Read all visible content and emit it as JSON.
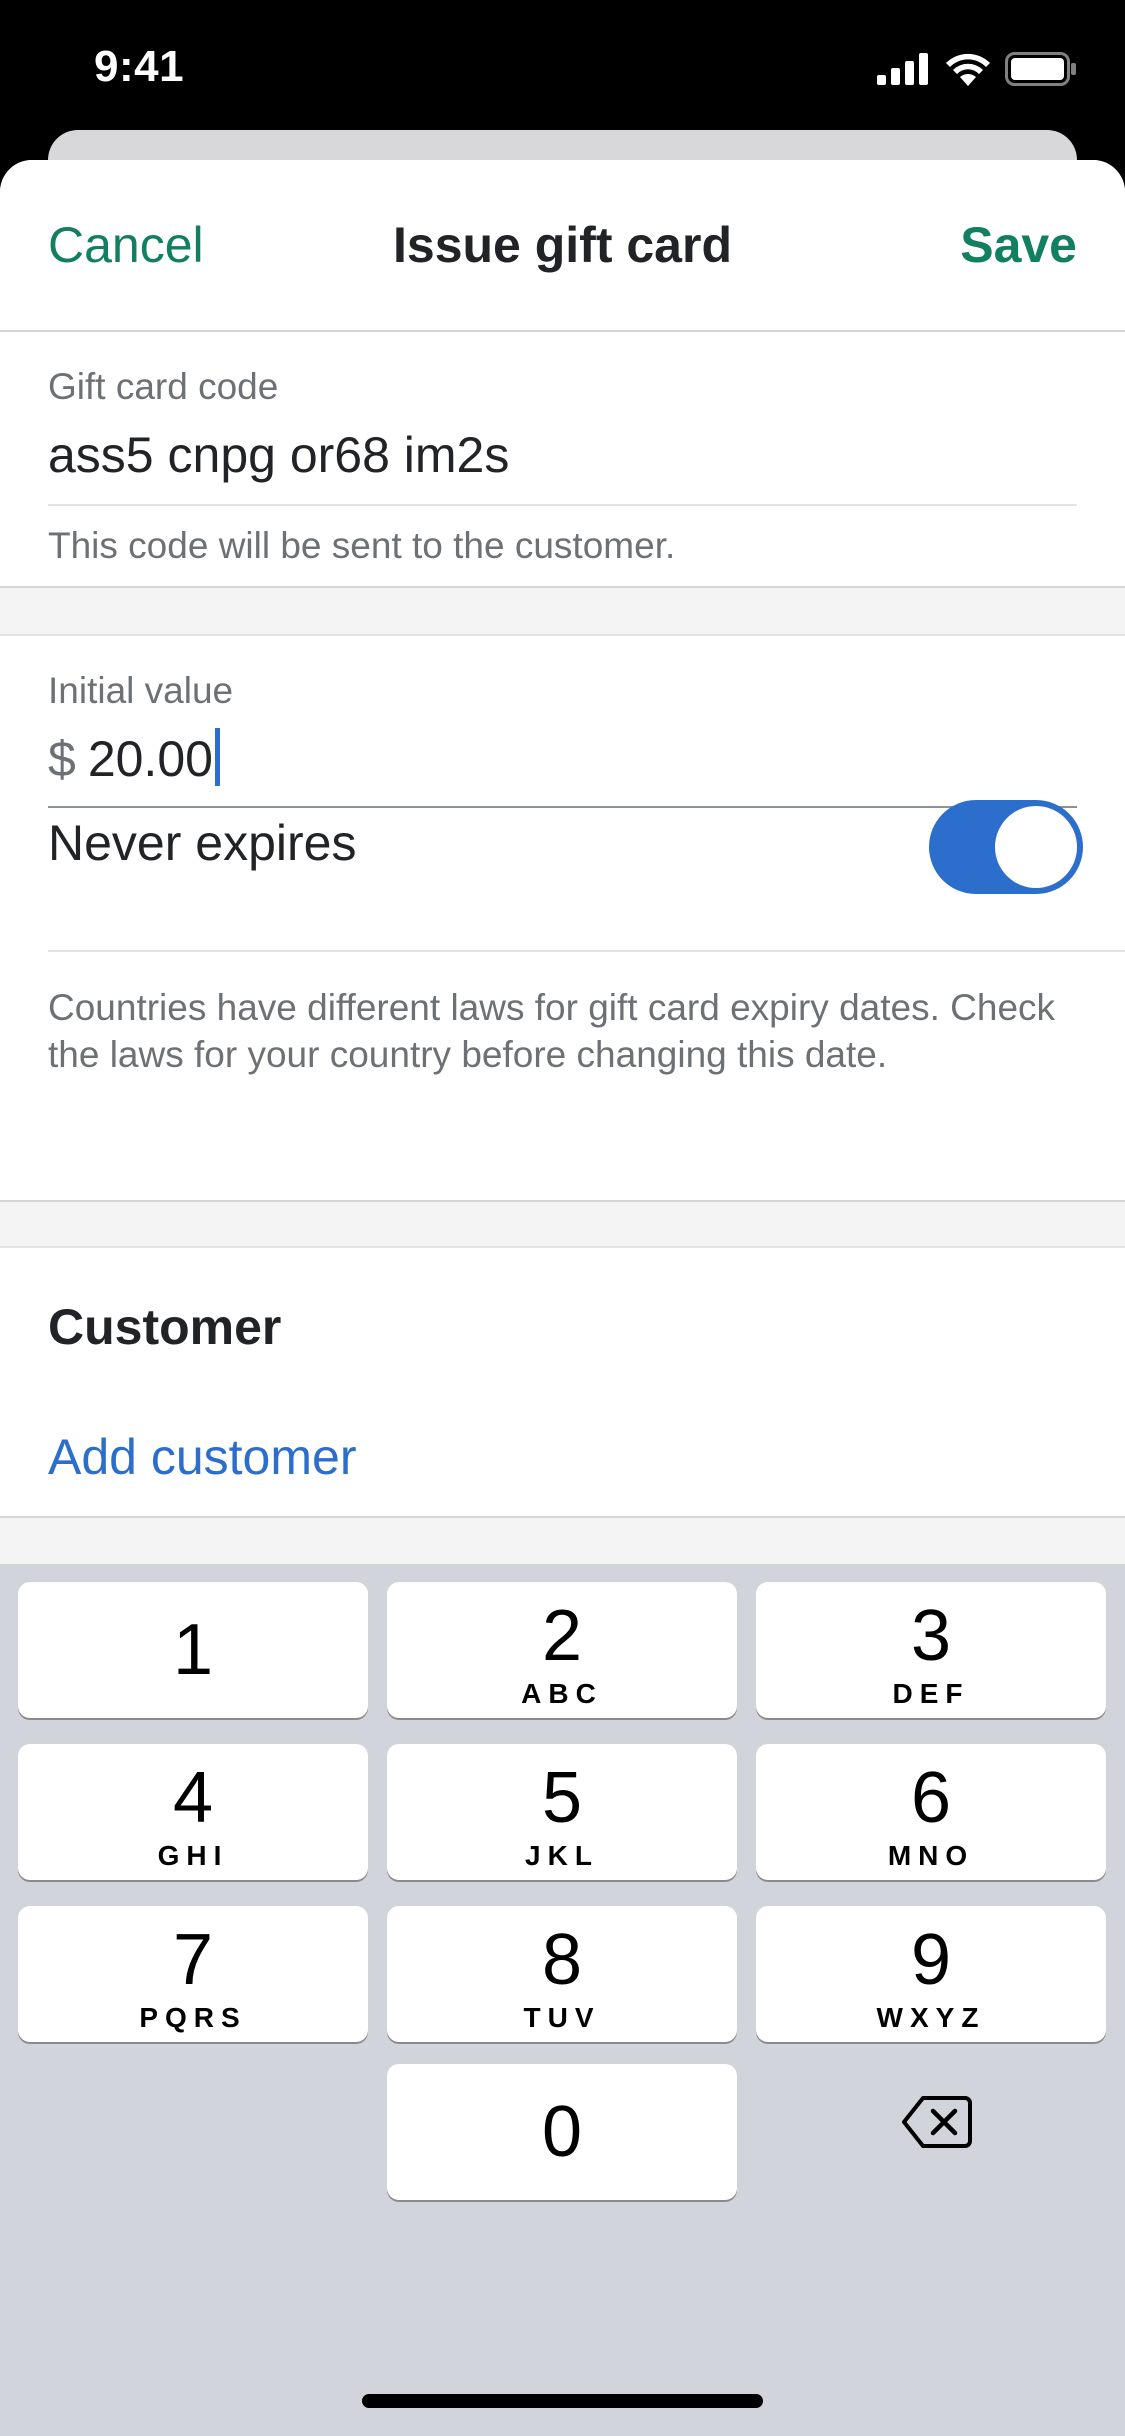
{
  "status_bar": {
    "time": "9:41"
  },
  "nav": {
    "cancel_label": "Cancel",
    "title": "Issue gift card",
    "save_label": "Save"
  },
  "gift_card": {
    "code_label": "Gift card code",
    "code_value": "ass5 cnpg or68 im2s",
    "code_help": "This code will be sent to the customer."
  },
  "value": {
    "label": "Initial value",
    "currency_symbol": "$",
    "amount": "20.00",
    "never_expires_label": "Never expires",
    "never_expires_on": true,
    "expiry_help": "Countries have different laws for gift card expiry dates. Check the laws for your country before changing this date."
  },
  "customer": {
    "title": "Customer",
    "add_label": "Add customer"
  },
  "keypad": {
    "keys": [
      {
        "num": "1",
        "letters": ""
      },
      {
        "num": "2",
        "letters": "ABC"
      },
      {
        "num": "3",
        "letters": "DEF"
      },
      {
        "num": "4",
        "letters": "GHI"
      },
      {
        "num": "5",
        "letters": "JKL"
      },
      {
        "num": "6",
        "letters": "MNO"
      },
      {
        "num": "7",
        "letters": "PQRS"
      },
      {
        "num": "8",
        "letters": "TUV"
      },
      {
        "num": "9",
        "letters": "WXYZ"
      },
      {
        "num": "0",
        "letters": ""
      }
    ]
  },
  "colors": {
    "primary_green": "#128060",
    "interactive_blue": "#2c6ecb",
    "keypad_bg": "#d1d4db"
  }
}
